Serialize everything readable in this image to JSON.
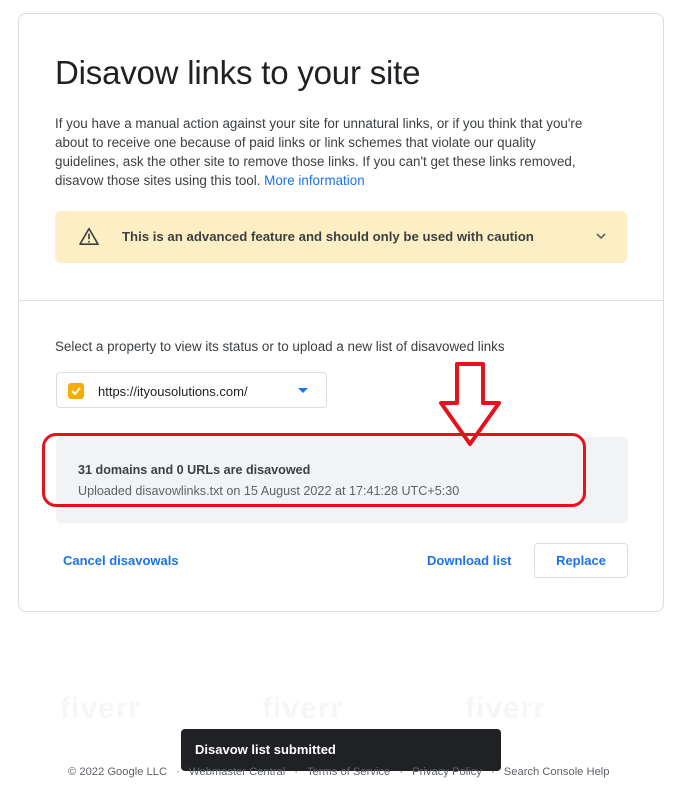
{
  "header": {
    "title": "Disavow links to your site",
    "description": "If you have a manual action against your site for unnatural links, or if you think that you're about to receive one because of paid links or link schemes that violate our quality guidelines, ask the other site to remove those links. If you can't get these links removed, disavow those sites using this tool.",
    "more_info_link": "More information"
  },
  "warning": {
    "text": "This is an advanced feature and should only be used with caution",
    "icon": "warning-icon",
    "background": "#fdefc3"
  },
  "property": {
    "label": "Select a property to view its status or to upload a new list of disavowed links",
    "selected": "https://ityousolutions.com/"
  },
  "status": {
    "summary": "31 domains and 0 URLs are disavowed",
    "uploaded": "Uploaded disavowlinks.txt on 15 August 2022 at 17:41:28 UTC+5:30",
    "highlight_color": "#e8101c"
  },
  "actions": {
    "cancel": "Cancel disavowals",
    "download": "Download list",
    "replace": "Replace"
  },
  "toast": {
    "message": "Disavow list submitted"
  },
  "footer": {
    "copyright": "© 2022 Google LLC",
    "links": [
      "Webmaster Central",
      "Terms of Service",
      "Privacy Policy",
      "Search Console Help"
    ]
  },
  "watermark": "fiverr",
  "colors": {
    "accent": "#1a73e8",
    "text": "#202124"
  }
}
